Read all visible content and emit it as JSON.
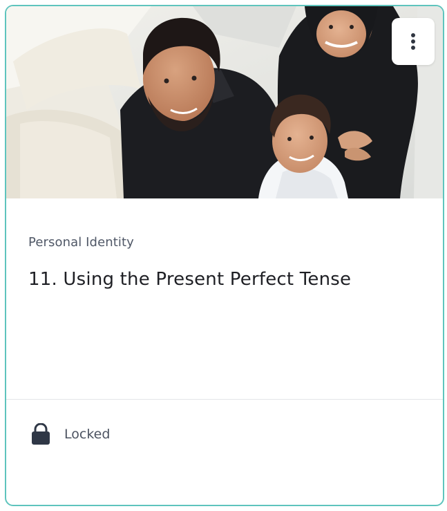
{
  "card": {
    "category": "Personal Identity",
    "title": "11. Using the Present Perfect Tense",
    "status": "Locked",
    "menu_icon": "more-vertical-icon",
    "status_icon": "lock-icon",
    "hero_image": "family-photo",
    "accent_color": "#5ec4bd"
  }
}
